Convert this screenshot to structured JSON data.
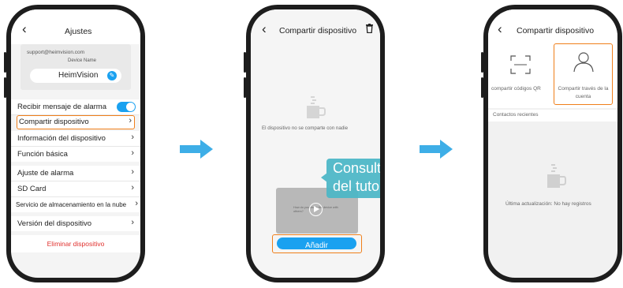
{
  "screen1": {
    "title": "Ajustes",
    "email": "support@heimvision.com",
    "device_name_caption": "Device Name",
    "device_name": "HeimVision",
    "alarm_toggle_label": "Recibir mensaje de alarma",
    "rows": [
      {
        "label": "Compartir dispositivo"
      },
      {
        "label": "Información del dispositivo"
      },
      {
        "label": "Función básica"
      },
      {
        "label": "Ajuste de alarma"
      },
      {
        "label": "SD Card"
      },
      {
        "label": "Servicio de almacenamiento en la nube"
      },
      {
        "label": "Versión del dispositivo"
      }
    ],
    "delete_label": "Eliminar dispositivo"
  },
  "screen2": {
    "title": "Compartir dispositivo",
    "empty_text": "El dispositivo no se comparte con nadie",
    "video_text": "How do you share the device with others?",
    "tooltip_line1": "Consulte el vídeo",
    "tooltip_line2": "del tutorial aquí",
    "add_button": "Añadir"
  },
  "screen3": {
    "title": "Compartir dispositivo",
    "option_qr": "compartir códigos QR",
    "option_account": "Compartir través de la cuenta",
    "recent_contacts": "Contactos recientes",
    "empty_text": "Última actualización: No hay registros"
  },
  "colors": {
    "accent_blue": "#1aa1f0",
    "highlight_orange": "#f07f1a",
    "arrow_blue": "#3eaee7",
    "tooltip_teal": "#4cb7c7",
    "delete_red": "#e0322f"
  }
}
